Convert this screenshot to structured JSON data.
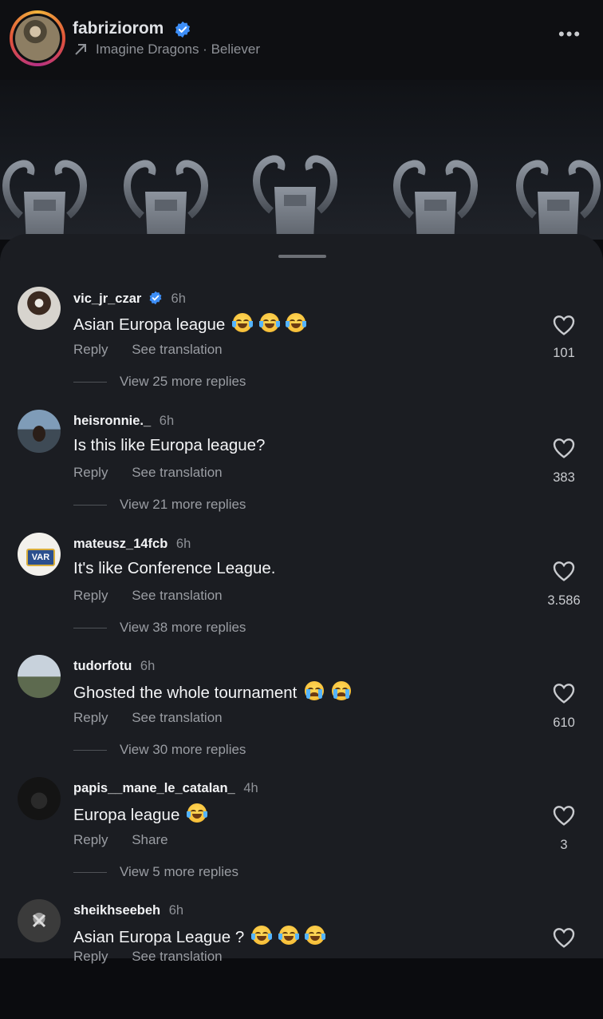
{
  "post": {
    "username": "fabriziorom",
    "music": "Imagine Dragons · Believer"
  },
  "comments": [
    {
      "username": "vic_jr_czar",
      "verified": true,
      "time": "6h",
      "text": "Asian Europa league",
      "emojis": [
        "laughing-tears",
        "laughing-tears",
        "laughing-tears"
      ],
      "actions": [
        "Reply",
        "See translation"
      ],
      "replies": "View 25 more replies",
      "likes": "101"
    },
    {
      "username": "heisronnie._",
      "verified": false,
      "time": "6h",
      "text": "Is this like Europa league?",
      "emojis": [],
      "actions": [
        "Reply",
        "See translation"
      ],
      "replies": "View 21 more replies",
      "likes": "383"
    },
    {
      "username": "mateusz_14fcb",
      "verified": false,
      "time": "6h",
      "text": "It's like Conference League.",
      "emojis": [],
      "actions": [
        "Reply",
        "See translation"
      ],
      "replies": "View 38 more replies",
      "likes": "3.586"
    },
    {
      "username": "tudorfotu",
      "verified": false,
      "time": "6h",
      "text": "Ghosted the whole tournament",
      "emojis": [
        "crying",
        "crying"
      ],
      "actions": [
        "Reply",
        "See translation"
      ],
      "replies": "View 30 more replies",
      "likes": "610"
    },
    {
      "username": "papis__mane_le_catalan_",
      "verified": false,
      "time": "4h",
      "text": "Europa league",
      "emojis": [
        "laughing-tears"
      ],
      "actions": [
        "Reply",
        "Share"
      ],
      "replies": "View 5 more replies",
      "likes": "3"
    },
    {
      "username": "sheikhseebeh",
      "verified": false,
      "time": "6h",
      "text": "Asian Europa League ?",
      "emojis": [
        "laughing-tears",
        "laughing-tears",
        "laughing-tears"
      ],
      "actions": [
        "Reply",
        "See translation"
      ],
      "replies": "",
      "likes": ""
    }
  ],
  "avatar_badge": "VAR",
  "colors": {
    "accent_verified": "#3d8ef7",
    "sheet_bg": "#1b1d22",
    "muted_text": "#9a9da3"
  }
}
